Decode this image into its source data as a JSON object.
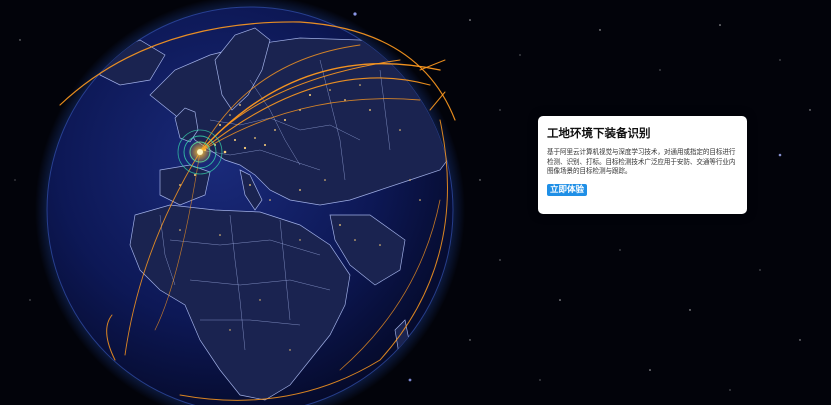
{
  "card": {
    "title": "工地环境下装备识别",
    "description": "基于阿里云计算机视觉与深度学习技术，对通用或指定的目标进行检测、识别、打标。目标检测技术广泛应用于安防、交通等行业内图像场景的目标检测与跟踪。",
    "button_label": "立即体验"
  },
  "colors": {
    "background": "#02030a",
    "globe_ocean": "#0e1a5a",
    "land_border": "#b8c8ff",
    "arc": "#ff9a1f",
    "hotspot": "#39e0b0",
    "button": "#1f8fe6"
  },
  "icons": [
    "globe-visual",
    "hotspot-marker-icon"
  ]
}
